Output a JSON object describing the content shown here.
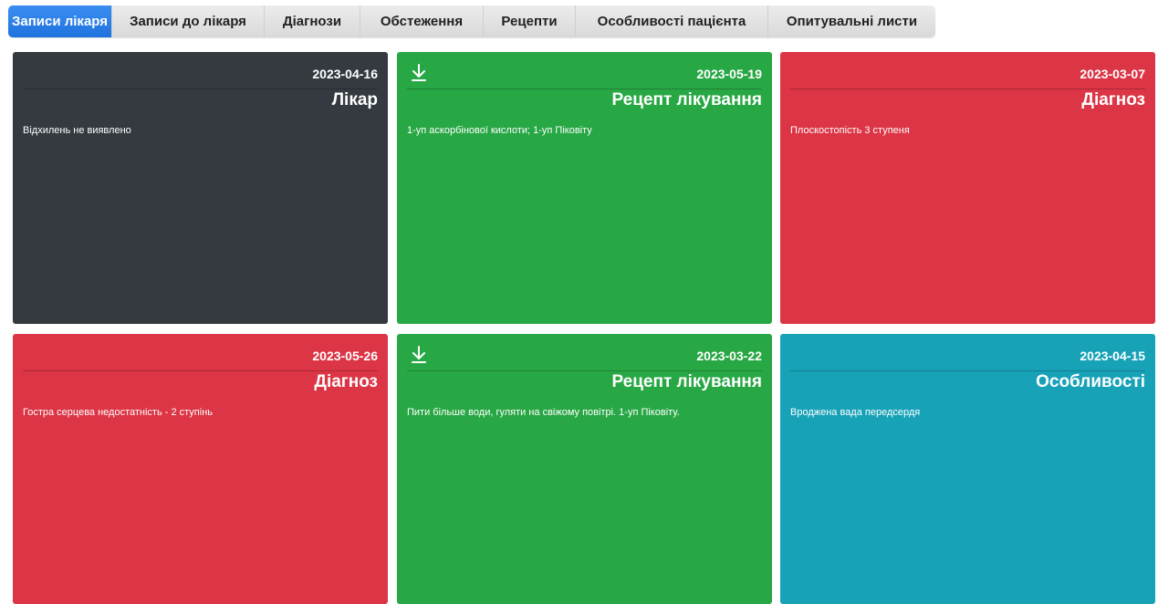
{
  "tabs": [
    {
      "label": "Записи лікаря",
      "active": true
    },
    {
      "label": "Записи до лікаря",
      "active": false
    },
    {
      "label": "Діагнози",
      "active": false
    },
    {
      "label": "Обстеження",
      "active": false
    },
    {
      "label": "Рецепти",
      "active": false
    },
    {
      "label": "Особливості пацієнта",
      "active": false
    },
    {
      "label": "Опитувальні листи",
      "active": false
    }
  ],
  "colors": {
    "dark": "#343a40",
    "green": "#28a745",
    "red": "#dc3545",
    "teal": "#17a2b8",
    "active_tab": "#2a7fe8"
  },
  "cards": [
    {
      "date": "2023-04-16",
      "title": "Лікар",
      "description": "Відхилень не виявлено",
      "color": "dark",
      "download": false
    },
    {
      "date": "2023-05-19",
      "title": "Рецепт лікування",
      "description": "1-уп аскорбінової кислоти; 1-уп Піковіту",
      "color": "green",
      "download": true,
      "download_icon": "download-icon"
    },
    {
      "date": "2023-03-07",
      "title": "Діагноз",
      "description": "Плоскостопість 3 ступеня",
      "color": "red",
      "download": false
    },
    {
      "date": "2023-05-26",
      "title": "Діагноз",
      "description": "Гостра серцева недостатність - 2 ступінь",
      "color": "red",
      "download": false
    },
    {
      "date": "2023-03-22",
      "title": "Рецепт лікування",
      "description": "Пити більше води, гуляти на свіжому повітрі. 1-уп Піковіту.",
      "color": "green",
      "download": true,
      "download_icon": "download-icon"
    },
    {
      "date": "2023-04-15",
      "title": "Особливості",
      "description": "Вроджена вада передсердя",
      "color": "teal",
      "download": false
    }
  ]
}
